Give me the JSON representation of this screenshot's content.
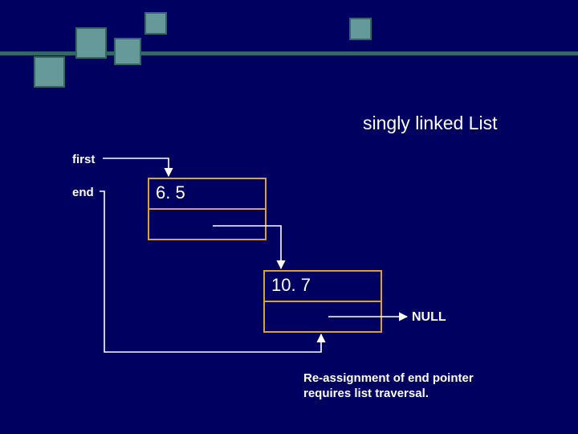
{
  "title": "singly linked List",
  "pointers": {
    "first": "first",
    "end": "end"
  },
  "nodes": [
    {
      "value": "6. 5"
    },
    {
      "value": "10. 7"
    }
  ],
  "null_label": "NULL",
  "caption_line1": "Re-assignment of end pointer",
  "caption_line2": "requires list traversal.",
  "colors": {
    "bg": "#000060",
    "accent": "#669999",
    "accent_dark": "#336666",
    "box": "#d8a23a",
    "text": "#ffffff"
  }
}
